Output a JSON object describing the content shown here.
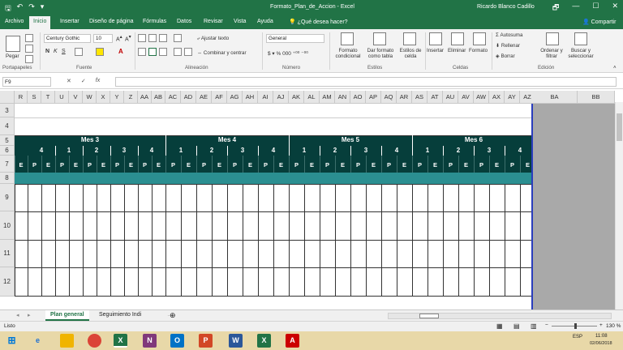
{
  "window": {
    "title": "Formato_Plan_de_Accion  -  Excel",
    "user": "Ricardo Blanco Cadillo",
    "controls": [
      "🗗",
      "—",
      "☐",
      "✕"
    ]
  },
  "tabs": [
    "Archivo",
    "Inicio",
    "Insertar",
    "Diseño de página",
    "Fórmulas",
    "Datos",
    "Revisar",
    "Vista",
    "Ayuda"
  ],
  "tell_me": "¿Qué desea hacer?",
  "share": "Compartir",
  "ribbon": {
    "paste": "Pegar",
    "font_name": "Century Gothic",
    "font_size": "10",
    "wrap_text": "Ajustar texto",
    "merge_center": "Combinar y centrar",
    "number_format": "General",
    "cond_format": [
      "Formato",
      "condicional"
    ],
    "format_table": [
      "Dar formato",
      "como tabla"
    ],
    "cell_styles": [
      "Estilos de",
      "celda"
    ],
    "insert": "Insertar",
    "delete": "Eliminar",
    "format": "Formato",
    "autosum": "Autosuma",
    "fill": "Rellenar",
    "clear": "Borrar",
    "sort_filter": [
      "Ordenar y",
      "filtrar"
    ],
    "find_select": [
      "Buscar y",
      "seleccionar"
    ],
    "groups": [
      "Portapapeles",
      "Fuente",
      "Alineación",
      "Número",
      "Estilos",
      "Celdas",
      "Edición"
    ]
  },
  "formula_bar": {
    "name_box": "F9",
    "fx": "fx",
    "value": ""
  },
  "columns": [
    "R",
    "S",
    "T",
    "U",
    "V",
    "W",
    "X",
    "Y",
    "Z",
    "AA",
    "AB",
    "AC",
    "AD",
    "AE",
    "AF",
    "AG",
    "AH",
    "AI",
    "AJ",
    "AK",
    "AL",
    "AM",
    "AN",
    "AO",
    "AP",
    "AQ",
    "AR",
    "AS",
    "AT",
    "AU",
    "AV",
    "AW",
    "AX",
    "AY",
    "AZ"
  ],
  "right_columns": [
    "BA",
    "BB"
  ],
  "rows": [
    "3",
    "4",
    "5",
    "6",
    "7",
    "8",
    "9",
    "10",
    "11",
    "12"
  ],
  "months": [
    "Mes 3",
    "Mes 4",
    "Mes 5",
    "Mes 6"
  ],
  "week_numbers": [
    "4",
    "1",
    "2",
    "3",
    "4",
    "1",
    "2",
    "3",
    "4",
    "1",
    "2",
    "3",
    "4",
    "1",
    "2",
    "3",
    "4"
  ],
  "pe_letters": [
    "E",
    "P",
    "E",
    "P",
    "E",
    "P",
    "E",
    "P",
    "E",
    "P",
    "E",
    "P",
    "E",
    "P",
    "E",
    "P",
    "E",
    "P",
    "E",
    "P",
    "E",
    "P",
    "E",
    "P",
    "E",
    "P",
    "E",
    "P",
    "E",
    "P",
    "E",
    "P",
    "E",
    "P",
    "E",
    "P",
    "E"
  ],
  "sheets": [
    "Plan general",
    "Seguimiento Indi"
  ],
  "status": {
    "ready": "Listo",
    "zoom": "130 %"
  },
  "taskbar": {
    "lang": "ESP",
    "time": "11:08",
    "date": "02/06/2018"
  },
  "colors": {
    "excel_green": "#217346",
    "header_band": "#063e3b",
    "teal_row": "#2b8f91"
  }
}
